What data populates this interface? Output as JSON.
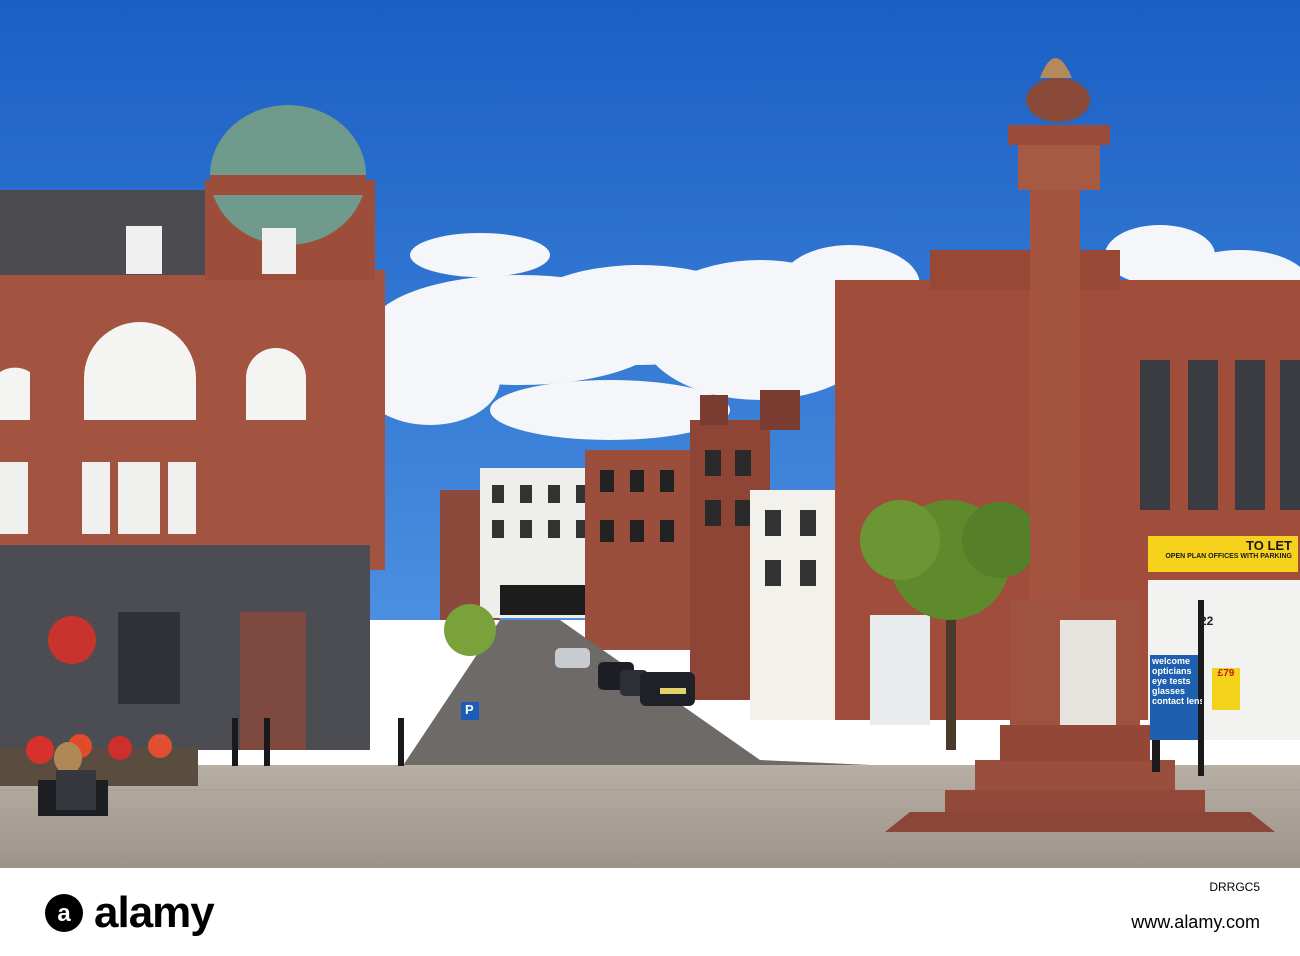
{
  "photo": {
    "description_tags": [
      "town-square",
      "sandstone-buildings",
      "monument-column",
      "street"
    ],
    "sky_color": "#1f6fd0",
    "sandstone_color": "#a0523f"
  },
  "signs": {
    "to_let": "TO LET",
    "to_let_sub": "OPEN PLAN OFFICES WITH PARKING",
    "welcome": "welcome",
    "opticians": "opticians",
    "eye_tests": "eye tests",
    "glasses": "glasses",
    "contact_lenses": "contact lenses",
    "price": "£79",
    "street_number": "22",
    "parking": "P"
  },
  "watermarks": {
    "mark": "a"
  },
  "footer": {
    "brand": "alamy",
    "stock_id": "DRRGC5",
    "url": "www.alamy.com"
  }
}
